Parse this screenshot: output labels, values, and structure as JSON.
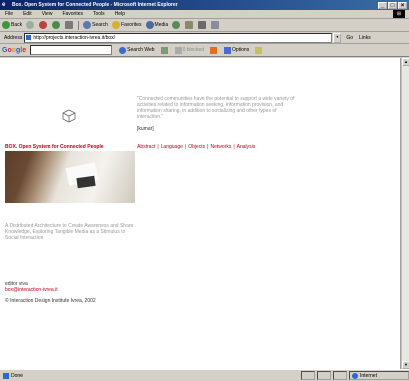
{
  "window": {
    "title": "Box. Open System for Connected People - Microsoft Internet Explorer",
    "controls": [
      "_",
      "□",
      "×"
    ]
  },
  "menu": [
    "File",
    "Edit",
    "View",
    "Favorites",
    "Tools",
    "Help"
  ],
  "toolbar": {
    "back": "Back",
    "search": "Search",
    "favorites": "Favorites",
    "media": "Media"
  },
  "address": {
    "label": "Address",
    "url": "http://projects.interaction-ivrea.it/box/",
    "go": "Go",
    "links": "Links"
  },
  "googlebar": {
    "logo": "Google",
    "search_web": "Search Web",
    "blocked": "0 blocked",
    "options": "Options"
  },
  "page": {
    "quote": "\"Connected communities have the potential to support a wide variety of activities related to information seeking, information provision, and information sharing, in addition to socializing and other types of interaction.\"",
    "author": "[kumar]",
    "site_title": "BOX. Open System for Connected People",
    "nav": [
      "Abstract",
      "Language",
      "Objects",
      "Networks",
      "Analysis"
    ],
    "tagline": "A Distributed Architecture to Create Awareness and Share Knowledge, Exploring Tangible Media as a Stimulus to Social Interaction",
    "editor": "editor viva",
    "email": "box@interaction-ivrea.it",
    "copyright": "© Interaction Design Institute Ivrea, 2002"
  },
  "status": {
    "text": "Done",
    "zone": "Internet"
  }
}
